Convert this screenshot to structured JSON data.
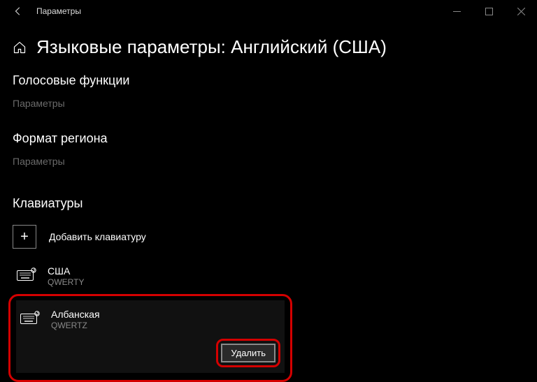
{
  "window": {
    "title": "Параметры"
  },
  "page": {
    "title": "Языковые параметры: Английский (США)"
  },
  "sections": {
    "speech": {
      "heading": "Голосовые функции",
      "link": "Параметры"
    },
    "region": {
      "heading": "Формат региона",
      "link": "Параметры"
    },
    "keyboards": {
      "heading": "Клавиатуры",
      "add_label": "Добавить клавиатуру"
    }
  },
  "keyboard_items": [
    {
      "name": "США",
      "layout": "QWERTY"
    },
    {
      "name": "Албанская",
      "layout": "QWERTZ"
    }
  ],
  "actions": {
    "remove": "Удалить"
  }
}
